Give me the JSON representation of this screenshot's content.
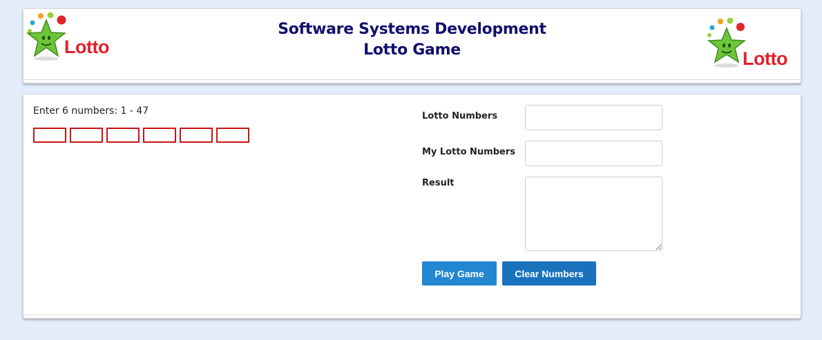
{
  "header": {
    "title_line1": "Software Systems Development",
    "title_line2": "Lotto Game",
    "logo_left_text": "Lotto",
    "logo_right_text": "Lotto"
  },
  "entry": {
    "instruction": "Enter 6 numbers: 1 - 47",
    "boxes": [
      "",
      "",
      "",
      "",
      "",
      ""
    ]
  },
  "results": {
    "lotto_numbers_label": "Lotto Numbers",
    "lotto_numbers_value": "",
    "my_numbers_label": "My Lotto Numbers",
    "my_numbers_value": "",
    "result_label": "Result",
    "result_value": ""
  },
  "buttons": {
    "play": "Play Game",
    "clear": "Clear Numbers"
  },
  "colors": {
    "page_bg": "#e3ecfa",
    "title": "#10106e",
    "number_box_border": "#c81414",
    "button_play": "#2286d1",
    "button_clear": "#1a72bd",
    "logo_text": "#e0202a",
    "star_green": "#6cc53a"
  }
}
